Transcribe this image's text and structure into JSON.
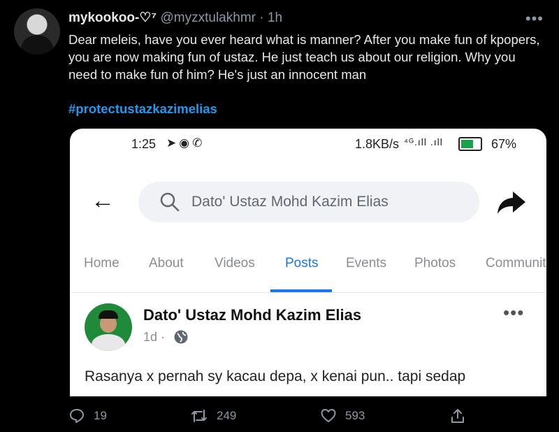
{
  "tweet": {
    "display_name": "mykookoo-♡⁷",
    "handle": "@myzxtulakhmr",
    "separator": "·",
    "time": "1h",
    "more_icon": "more-icon",
    "text": "Dear meleis, have you ever heard what is manner? After you make fun of kpopers, you are now making fun of ustaz. He just teach us about our religion. Why you need to make fun of him? He's just an innocent man",
    "hashtag": "#protectustazkazimelias"
  },
  "screenshot": {
    "status_bar": {
      "time": "1:25",
      "speed": "1.8KB/s",
      "network": "⁴ᴳ.ıll .ıll",
      "battery_level": 0.67,
      "battery_text": "67%"
    },
    "search_placeholder": "Dato' Ustaz Mohd Kazim Elias",
    "tabs": [
      {
        "label": "Home"
      },
      {
        "label": "About"
      },
      {
        "label": "Videos"
      },
      {
        "label": "Posts"
      },
      {
        "label": "Events"
      },
      {
        "label": "Photos"
      },
      {
        "label": "Communit"
      }
    ],
    "active_tab": "Posts",
    "post": {
      "author": "Dato' Ustaz Mohd Kazim Elias",
      "time": "1d ·",
      "text": "Rasanya x pernah sy kacau depa, x kenai pun.. tapi sedap"
    }
  },
  "actions": {
    "replies": "19",
    "retweets": "249",
    "likes": "593"
  },
  "colors": {
    "background": "#000000",
    "link": "#1d9bf0",
    "fb_blue": "#1877f2",
    "muted": "#8b98a5"
  }
}
